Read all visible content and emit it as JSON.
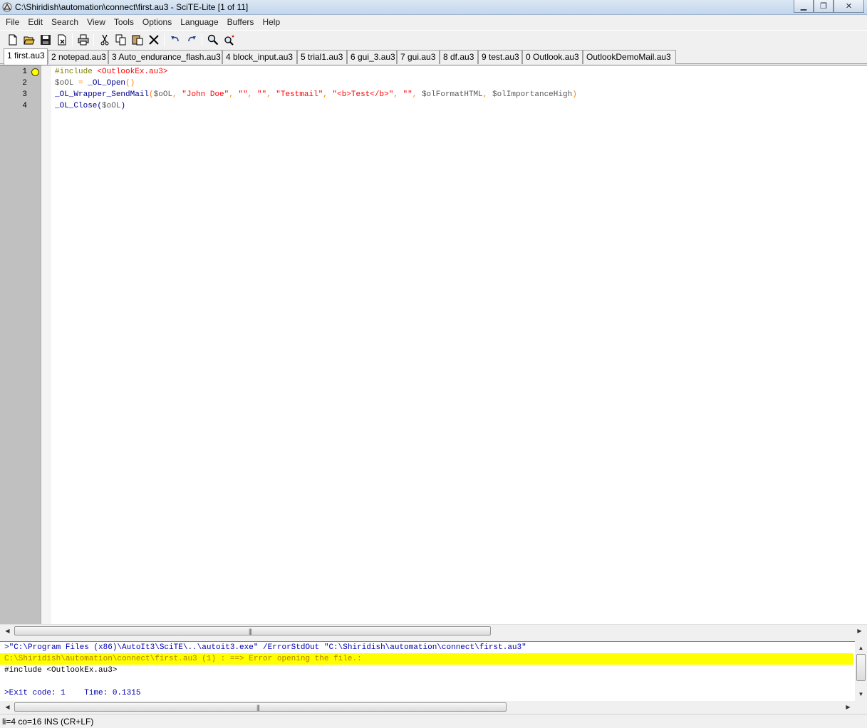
{
  "window": {
    "title": "C:\\Shiridish\\automation\\connect\\first.au3 - SciTE-Lite [1 of 11]",
    "minimize_glyph": "▁",
    "maximize_glyph": "❐",
    "close_glyph": "✕"
  },
  "menu": [
    "File",
    "Edit",
    "Search",
    "View",
    "Tools",
    "Options",
    "Language",
    "Buffers",
    "Help"
  ],
  "toolbar_icons": [
    "new-file-icon",
    "open-folder-icon",
    "save-icon",
    "close-file-icon",
    "print-icon",
    "cut-icon",
    "copy-icon",
    "paste-icon",
    "delete-icon",
    "undo-icon",
    "redo-icon",
    "find-icon",
    "replace-icon"
  ],
  "tabs": [
    {
      "label": "1 first.au3",
      "active": true
    },
    {
      "label": "2 notepad.au3"
    },
    {
      "label": "3 Auto_endurance_flash.au3"
    },
    {
      "label": "4 block_input.au3"
    },
    {
      "label": "5 trial1.au3"
    },
    {
      "label": "6 gui_3.au3"
    },
    {
      "label": "7 gui.au3"
    },
    {
      "label": "8 df.au3"
    },
    {
      "label": "9 test.au3"
    },
    {
      "label": "0 Outlook.au3"
    },
    {
      "label": "OutlookDemoMail.au3"
    }
  ],
  "editor": {
    "line_numbers": [
      "1",
      "2",
      "3",
      "4"
    ],
    "lines": {
      "l1": {
        "directive": "#include ",
        "file": "<OutlookEx.au3>"
      },
      "l2": {
        "var": "$oOL",
        "eq": " = ",
        "fn": "_OL_Open",
        "parens": "()"
      },
      "l3": {
        "fn": "_OL_Wrapper_SendMail",
        "open": "(",
        "a1": "$oOL",
        "c1": ", ",
        "a2": "\"John Doe\"",
        "c2": ", ",
        "a3": "\"\"",
        "c3": ", ",
        "a4": "\"\"",
        "c4": ", ",
        "a5": "\"Testmail\"",
        "c5": ", ",
        "a6": "\"<b>Test</b>\"",
        "c6": ", ",
        "a7": "\"\"",
        "c7": ", ",
        "a8": "$olFormatHTML",
        "c8": ", ",
        "a9": "$olImportanceHigh",
        "close": ")"
      },
      "l4": {
        "fn": "_OL_Close",
        "open": "(",
        "var": "$oOL",
        "close": ")"
      }
    }
  },
  "output": {
    "lines": [
      ">\"C:\\Program Files (x86)\\AutoIt3\\SciTE\\..\\autoit3.exe\" /ErrorStdOut \"C:\\Shiridish\\automation\\connect\\first.au3\"",
      "C:\\Shiridish\\automation\\connect\\first.au3 (1) : ==> Error opening the file.:",
      "#include <OutlookEx.au3>",
      "",
      ">Exit code: 1    Time: 0.1315"
    ]
  },
  "statusbar": {
    "text": "li=4 co=16 INS (CR+LF)"
  },
  "colors": {
    "bookmark": "#ffff00",
    "error_highlight": "#ffff00",
    "string": "#ff0000",
    "function": "#000090",
    "operator": "#ff8000"
  }
}
